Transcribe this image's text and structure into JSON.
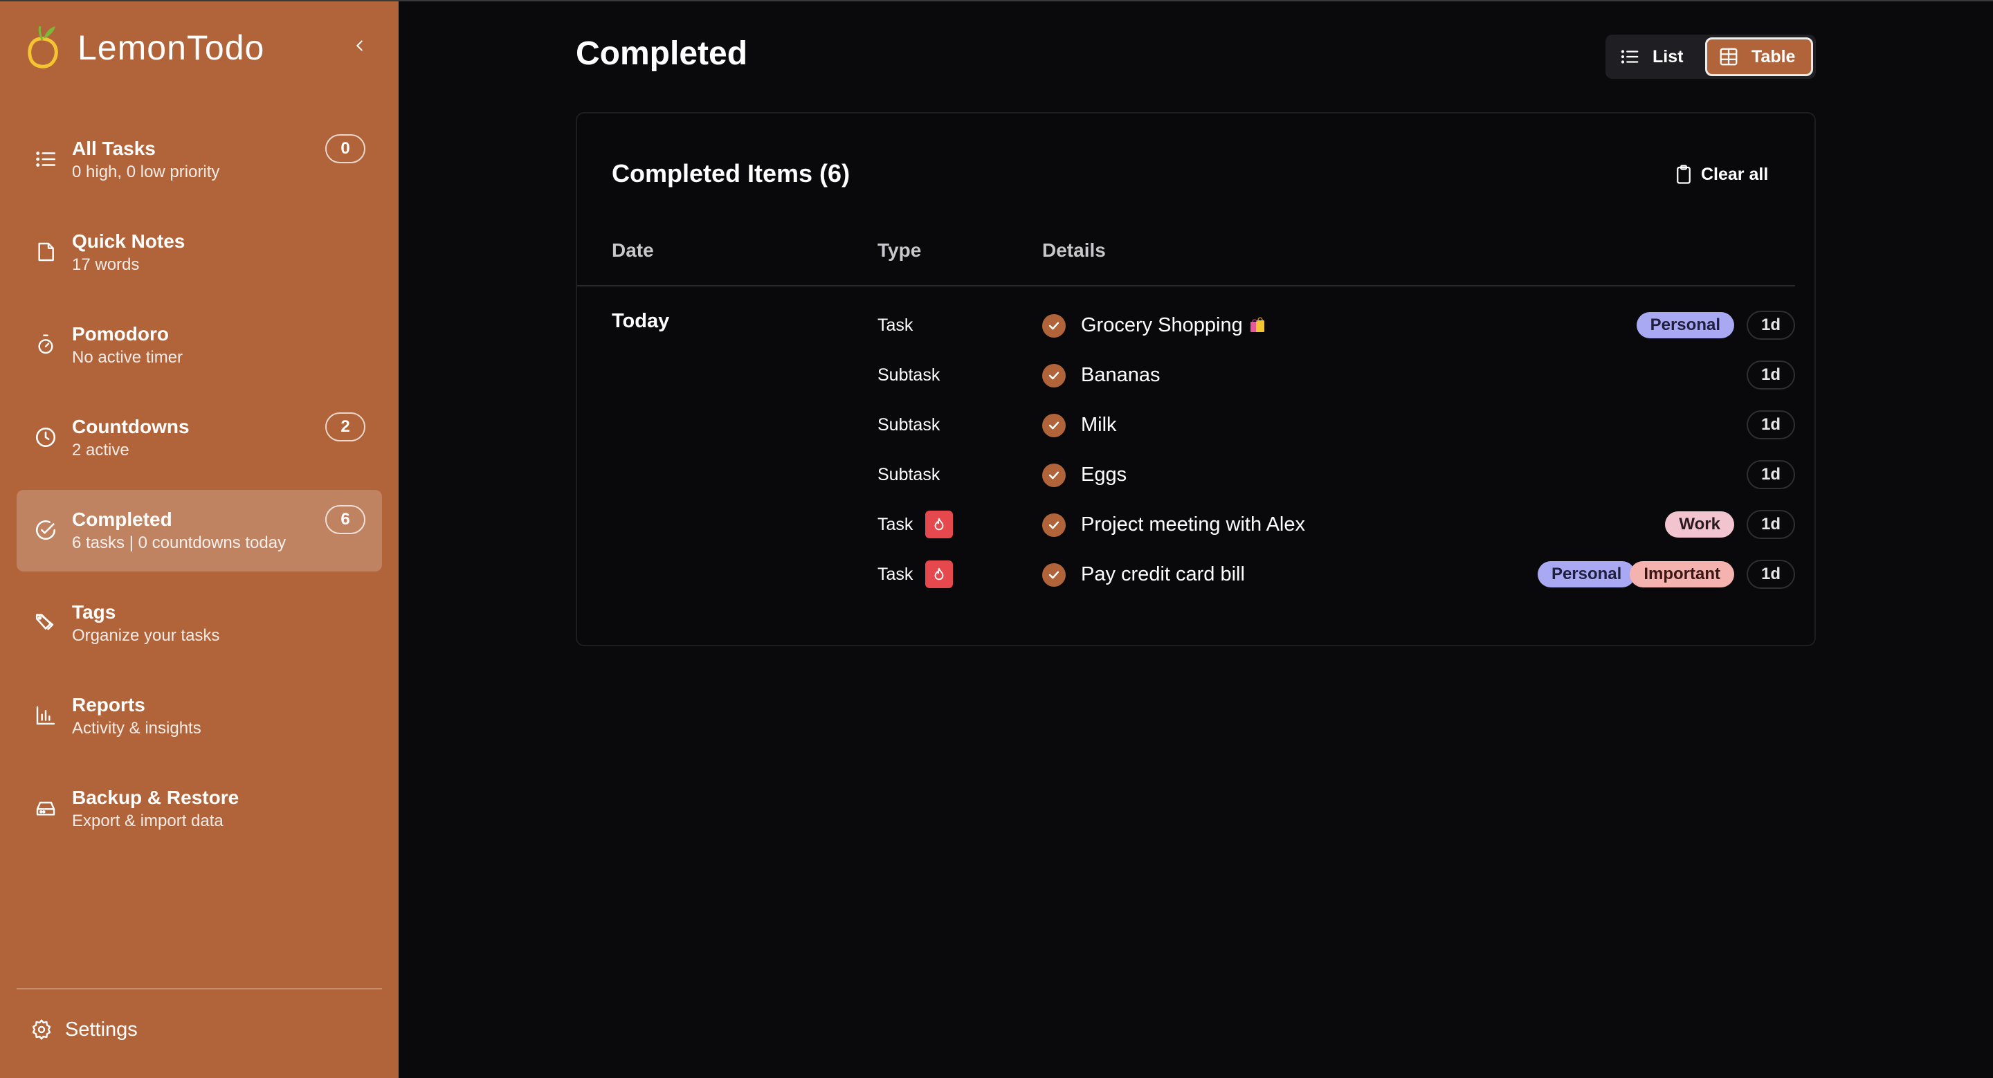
{
  "app": {
    "name": "LemonTodo"
  },
  "sidebar": {
    "items": [
      {
        "key": "all-tasks",
        "label": "All Tasks",
        "sub": "0 high, 0 low priority",
        "badge": "0"
      },
      {
        "key": "quick-notes",
        "label": "Quick Notes",
        "sub": "17 words"
      },
      {
        "key": "pomodoro",
        "label": "Pomodoro",
        "sub": "No active timer"
      },
      {
        "key": "countdowns",
        "label": "Countdowns",
        "sub": "2 active",
        "badge": "2"
      },
      {
        "key": "completed",
        "label": "Completed",
        "sub": "6 tasks | 0 countdowns today",
        "badge": "6",
        "active": true
      },
      {
        "key": "tags",
        "label": "Tags",
        "sub": "Organize your tasks"
      },
      {
        "key": "reports",
        "label": "Reports",
        "sub": "Activity & insights"
      },
      {
        "key": "backup",
        "label": "Backup & Restore",
        "sub": "Export & import data"
      }
    ],
    "settings_label": "Settings"
  },
  "main": {
    "title": "Completed",
    "view_toggle": {
      "list_label": "List",
      "table_label": "Table",
      "selected": "Table"
    },
    "card": {
      "title": "Completed Items (6)",
      "clear_label": "Clear all",
      "columns": [
        "Date",
        "Type",
        "Details"
      ],
      "group_date": "Today",
      "rows": [
        {
          "type": "Task",
          "flag": false,
          "text": "Grocery Shopping",
          "emoji": "shopping-bags",
          "tags": [
            "Personal"
          ],
          "age": "1d"
        },
        {
          "type": "Subtask",
          "flag": false,
          "text": "Bananas",
          "tags": [],
          "age": "1d"
        },
        {
          "type": "Subtask",
          "flag": false,
          "text": "Milk",
          "tags": [],
          "age": "1d"
        },
        {
          "type": "Subtask",
          "flag": false,
          "text": "Eggs",
          "tags": [],
          "age": "1d"
        },
        {
          "type": "Task",
          "flag": true,
          "text": "Project meeting with Alex",
          "tags": [
            "Work"
          ],
          "age": "1d"
        },
        {
          "type": "Task",
          "flag": true,
          "text": "Pay credit card bill",
          "tags": [
            "Personal",
            "Important"
          ],
          "age": "1d"
        }
      ]
    }
  },
  "colors": {
    "accent": "#b1643a",
    "background": "#0a0a0c",
    "flag": "#e5484d"
  }
}
